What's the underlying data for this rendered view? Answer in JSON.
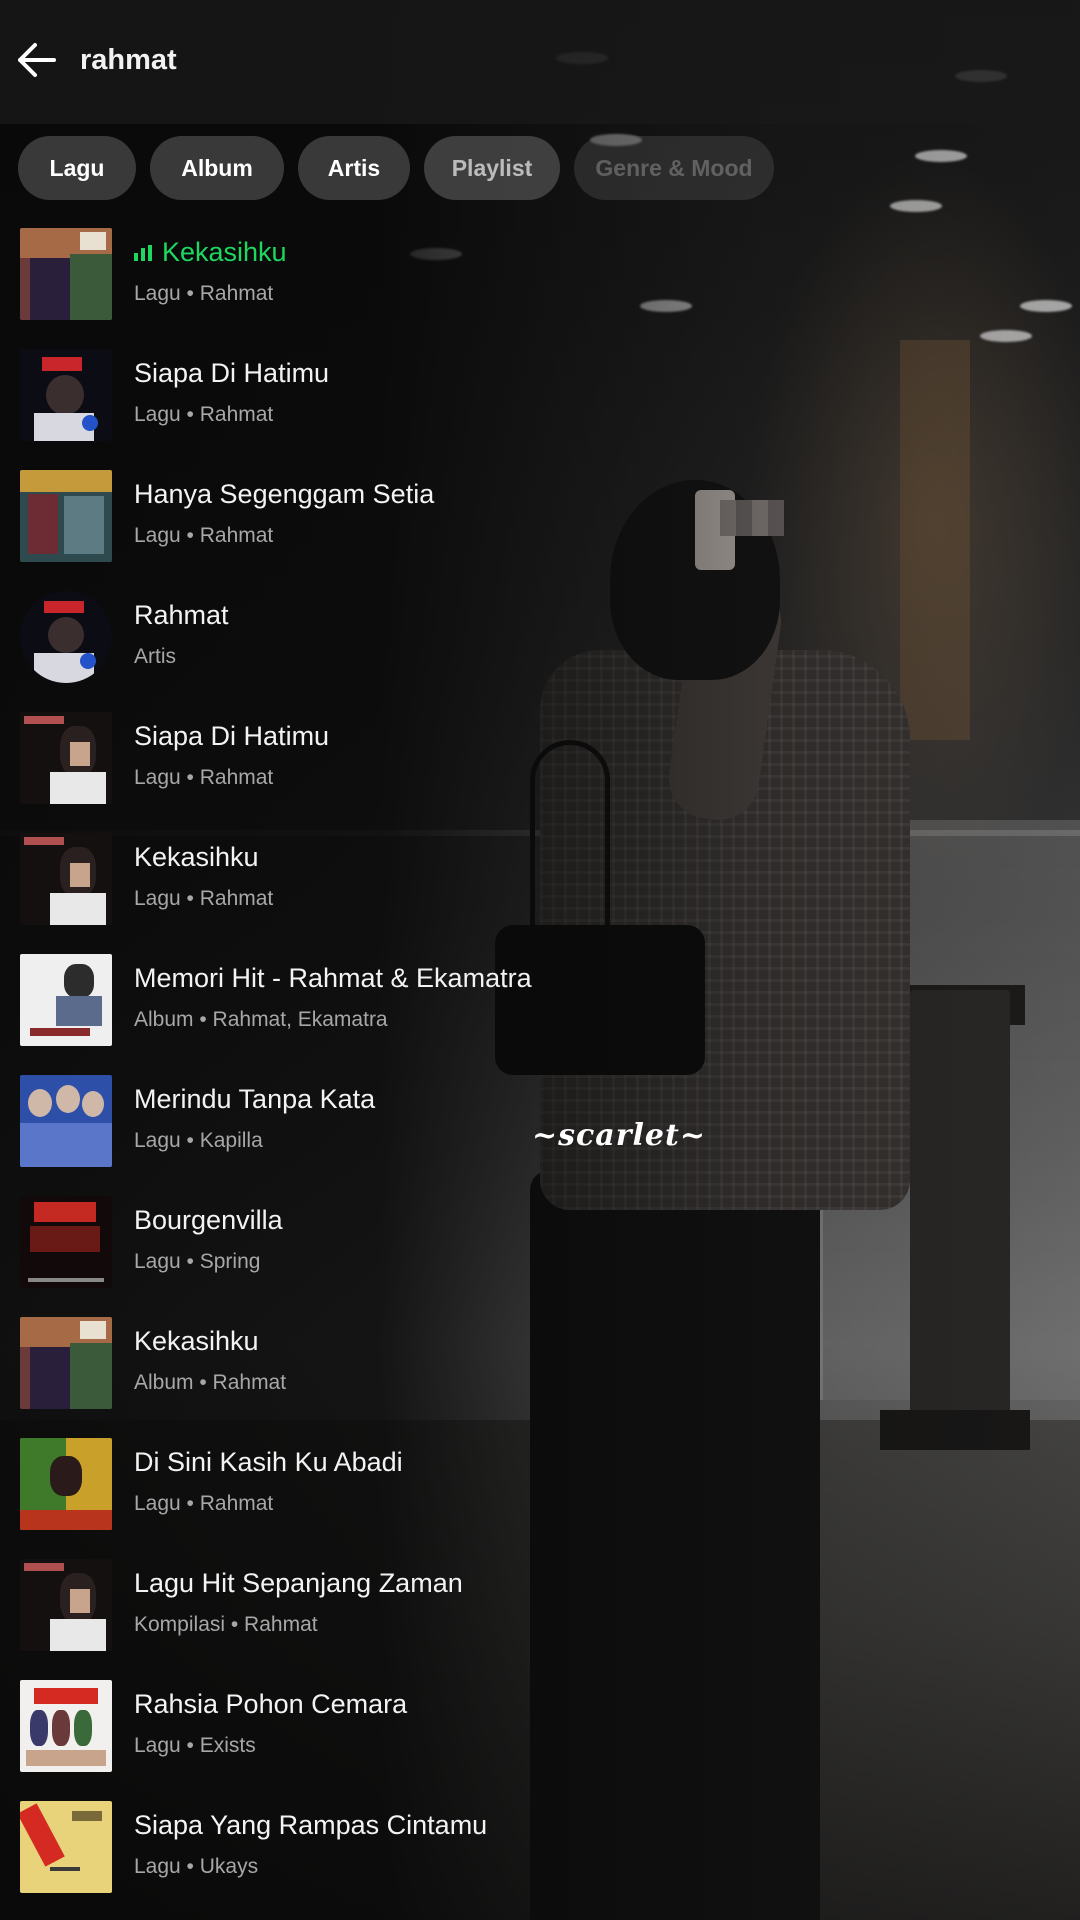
{
  "search": {
    "query": "rahmat"
  },
  "filters": [
    "Lagu",
    "Album",
    "Artis",
    "Playlist",
    "Genre & Mood"
  ],
  "results": [
    {
      "title": "Kekasihku",
      "subtitle": "Lagu • Rahmat",
      "playing": true
    },
    {
      "title": "Siapa Di Hatimu",
      "subtitle": "Lagu • Rahmat",
      "playing": false
    },
    {
      "title": "Hanya Segenggam Setia",
      "subtitle": "Lagu • Rahmat",
      "playing": false
    },
    {
      "title": "Rahmat",
      "subtitle": "Artis",
      "playing": false
    },
    {
      "title": "Siapa Di Hatimu",
      "subtitle": "Lagu • Rahmat",
      "playing": false
    },
    {
      "title": "Kekasihku",
      "subtitle": "Lagu • Rahmat",
      "playing": false
    },
    {
      "title": "Memori Hit - Rahmat & Ekamatra",
      "subtitle": "Album • Rahmat, Ekamatra",
      "playing": false
    },
    {
      "title": "Merindu Tanpa Kata",
      "subtitle": "Lagu • Kapilla",
      "playing": false
    },
    {
      "title": "Bourgenvilla",
      "subtitle": "Lagu • Spring",
      "playing": false
    },
    {
      "title": "Kekasihku",
      "subtitle": "Album • Rahmat",
      "playing": false
    },
    {
      "title": "Di Sini Kasih Ku Abadi",
      "subtitle": "Lagu • Rahmat",
      "playing": false
    },
    {
      "title": "Lagu Hit Sepanjang Zaman",
      "subtitle": "Kompilasi • Rahmat",
      "playing": false
    },
    {
      "title": "Rahsia Pohon Cemara",
      "subtitle": "Lagu • Exists",
      "playing": false
    },
    {
      "title": "Siapa Yang Rampas Cintamu",
      "subtitle": "Lagu • Ukays",
      "playing": false
    }
  ],
  "watermark": "~scarlet~",
  "colors": {
    "accent": "#1ed760",
    "text": "#ffffff",
    "subtext": "#a7a7a7",
    "chip": "#3e3e3e"
  },
  "icons": {
    "back": "arrow-left-icon",
    "now_playing": "equalizer-icon"
  }
}
